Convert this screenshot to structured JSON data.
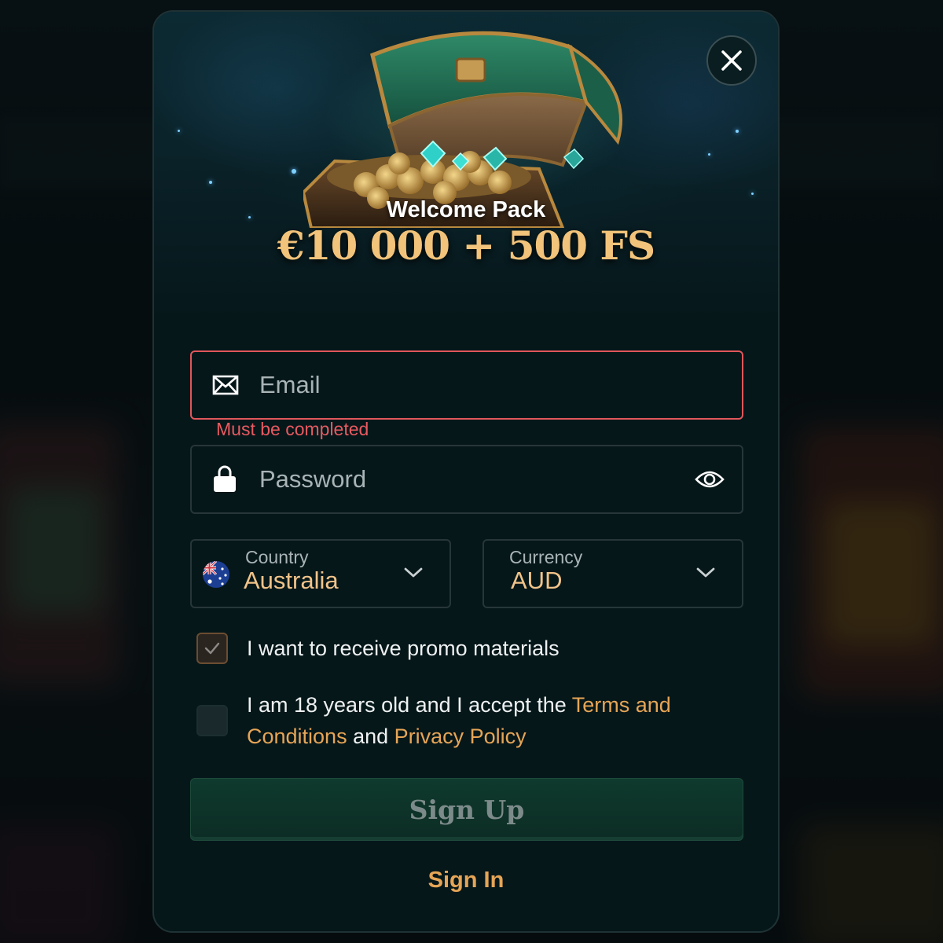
{
  "hero": {
    "subtitle": "Welcome Pack",
    "title": "€10 000 + 500 FS",
    "image": "treasure-chest-with-coins-and-gems"
  },
  "close_icon": "close-icon",
  "email": {
    "placeholder": "Email",
    "value": "",
    "icon": "envelope-icon",
    "error": "Must be completed"
  },
  "password": {
    "placeholder": "Password",
    "value": "",
    "icon": "lock-icon",
    "toggle_icon": "eye-icon"
  },
  "country": {
    "label": "Country",
    "value": "Australia",
    "flag": "australia-flag-icon"
  },
  "currency": {
    "label": "Currency",
    "value": "AUD"
  },
  "promo": {
    "checked": true,
    "label": "I want to receive promo materials"
  },
  "terms": {
    "checked": false,
    "text_before": "I am 18 years old and I accept the ",
    "terms_link": "Terms and Conditions",
    "text_mid": " and ",
    "privacy_link": "Privacy Policy"
  },
  "signup_label": "Sign Up",
  "signin_label": "Sign In",
  "colors": {
    "accent": "#e6a556",
    "gold_title": "#f2c37a",
    "error": "#e0575b",
    "modal_bg": "#06171a",
    "button_green": "#0f3a2e"
  }
}
